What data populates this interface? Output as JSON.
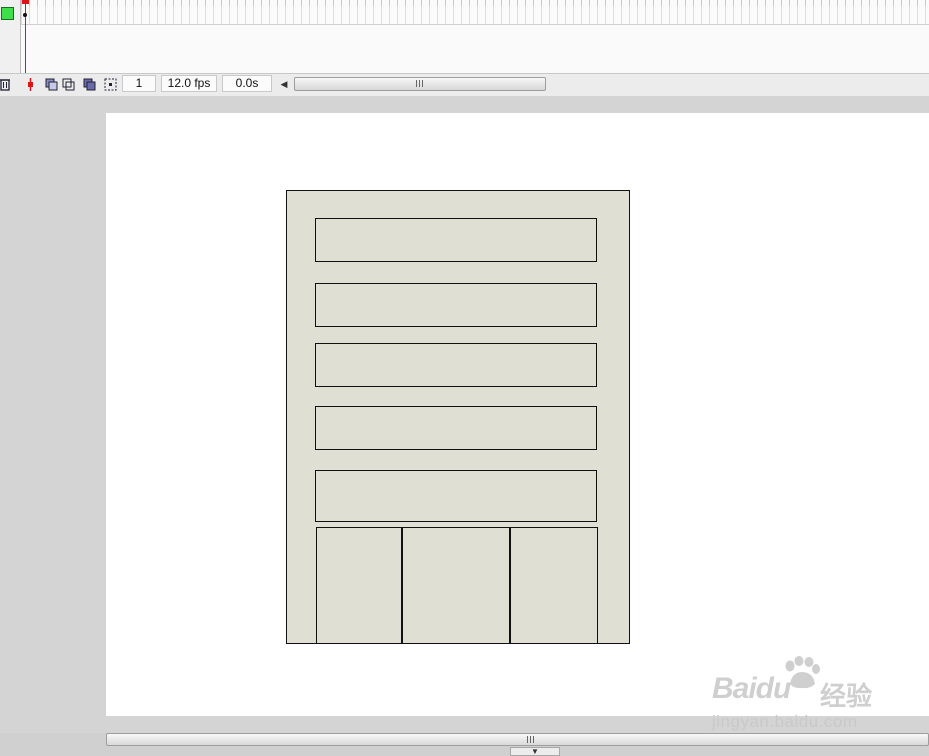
{
  "timeline": {
    "current_frame": "1",
    "frame_rate": "12.0 fps",
    "elapsed_time": "0.0s",
    "layer_color": "#3ee04a",
    "playhead_color": "#d81818",
    "icons": {
      "trash": "trash-icon",
      "center_frame": "center-frame-icon",
      "onion_skin": "onion-skin-icon",
      "onion_skin_outlines": "onion-skin-outlines-icon",
      "edit_multiple_frames": "edit-multiple-frames-icon",
      "modify_onion_markers": "modify-onion-markers-icon",
      "scroll_left": "chevron-left-icon"
    },
    "scroll_grip": "III"
  },
  "stage": {
    "background": "#ffffff",
    "form_fill": "#dfdfd4",
    "form_stroke": "#111111",
    "field_count": 5,
    "bottom_cell_count": 3
  },
  "bottom_scrollbar": {
    "grip": "III",
    "tab_arrow": "▼"
  },
  "watermark": {
    "logo": "Baidu",
    "logo_cn": "经验",
    "url": "jingyan.baidu.com"
  }
}
